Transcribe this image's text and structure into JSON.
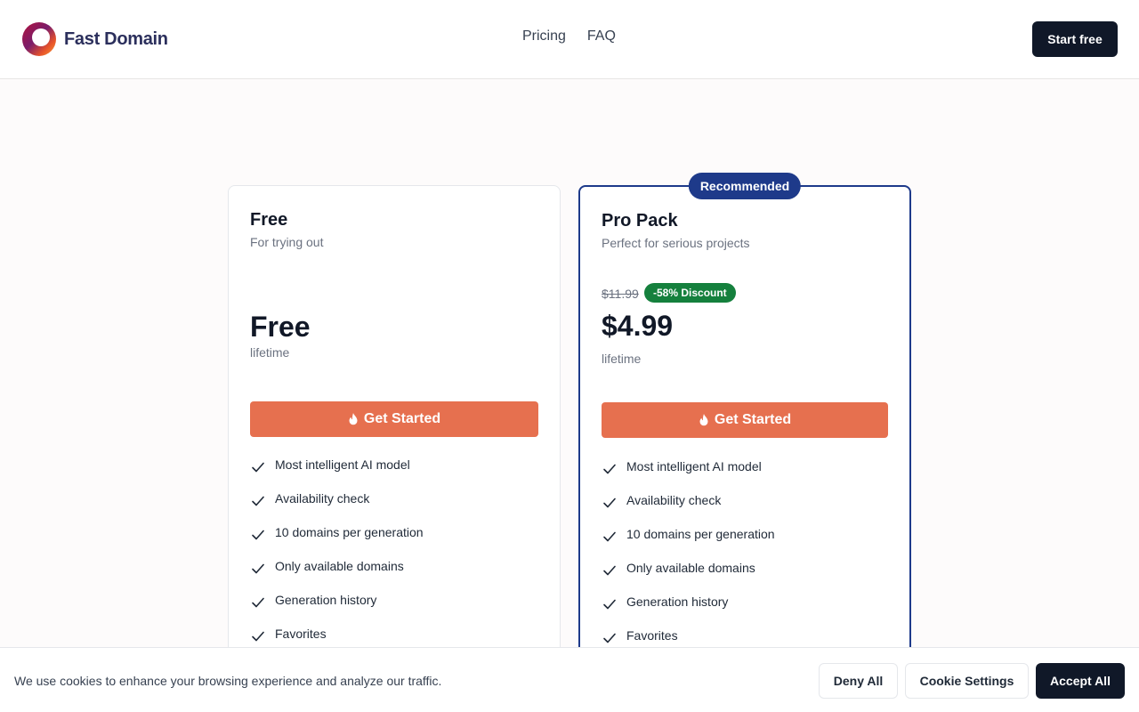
{
  "header": {
    "brand": "Fast Domain",
    "nav": [
      "Pricing",
      "FAQ"
    ],
    "start_button": "Start free"
  },
  "plans": {
    "free": {
      "name": "Free",
      "subtitle": "For trying out",
      "price": "Free",
      "period": "lifetime",
      "cta": "Get Started",
      "features": [
        "Most intelligent AI model",
        "Availability check",
        "10 domains per generation",
        "Only available domains",
        "Generation history",
        "Favorites"
      ]
    },
    "pro": {
      "badge": "Recommended",
      "name": "Pro Pack",
      "subtitle": "Perfect for serious projects",
      "old_price": "$11.99",
      "discount": "-58% Discount",
      "price": "$4.99",
      "period": "lifetime",
      "cta": "Get Started",
      "features": [
        "Most intelligent AI model",
        "Availability check",
        "10 domains per generation",
        "Only available domains",
        "Generation history",
        "Favorites"
      ]
    }
  },
  "cookie": {
    "text": "We use cookies to enhance your browsing experience and analyze our traffic.",
    "deny": "Deny All",
    "settings": "Cookie Settings",
    "accept": "Accept All"
  },
  "colors": {
    "accent": "#e6704f",
    "navy": "#1e3a8a",
    "dark": "#101828",
    "discount_green": "#15803d"
  },
  "icons": {
    "logo": "fast-domain-logo-icon",
    "cta": "flame-icon",
    "feature": "check-icon"
  }
}
